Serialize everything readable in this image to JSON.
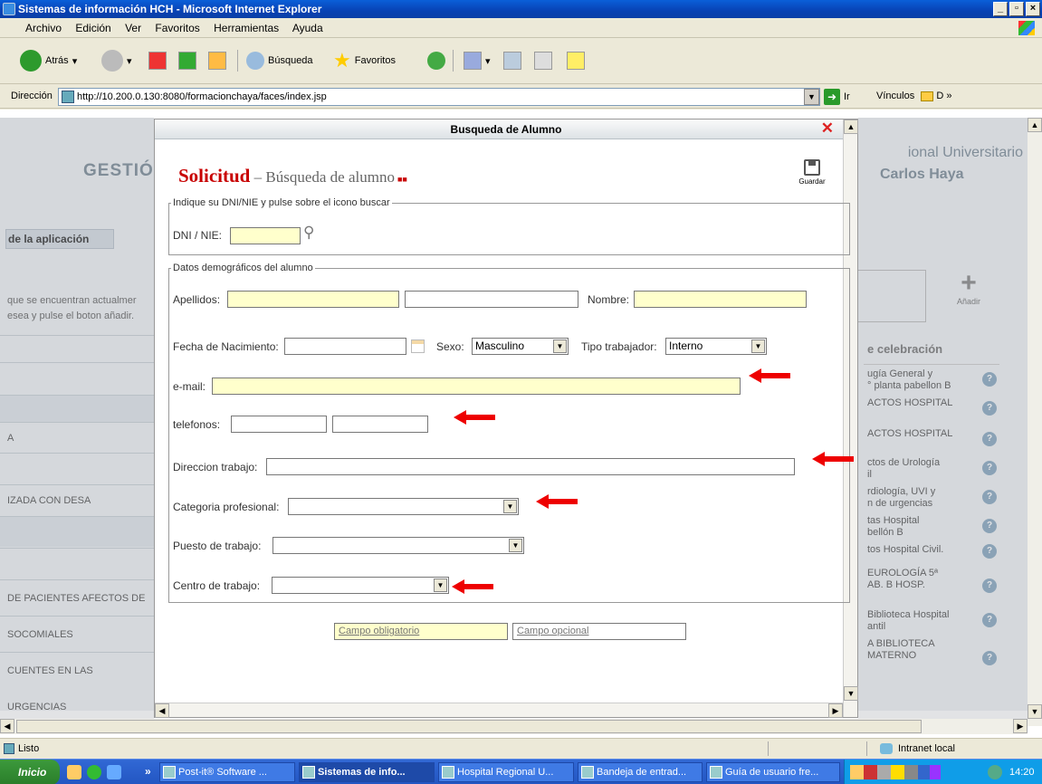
{
  "window": {
    "title": "Sistemas de información HCH - Microsoft Internet Explorer"
  },
  "menu": [
    "Archivo",
    "Edición",
    "Ver",
    "Favoritos",
    "Herramientas",
    "Ayuda"
  ],
  "toolbar": {
    "back": "Atrás",
    "search": "Búsqueda",
    "favorites": "Favoritos"
  },
  "address": {
    "label": "Dirección",
    "url": "http://10.200.0.130:8080/formacionchaya/faces/index.jsp",
    "go": "Ir",
    "links": "Vínculos",
    "links_item": "D"
  },
  "background": {
    "gestion": "GESTIÓN",
    "ayuda": "de la aplicación",
    "desc_line1": "que se encuentran actualmer",
    "desc_line2": "esea y pulse el boton añadir.",
    "right_title1": "ional Universitario",
    "right_title2": "Carlos Haya",
    "add_label": "Añadir",
    "celebracion": "e celebración",
    "rows_left": [
      "A",
      "IZADA CON DESA",
      "DE PACIENTES AFECTOS DE",
      "SOCOMIALES",
      "CUENTES EN LAS URGENCIAS"
    ],
    "rows_right": [
      "ugía General y\n° planta pabellon B",
      "ACTOS HOSPITAL",
      "ACTOS HOSPITAL",
      "ctos de Urología\nil",
      "rdiología, UVI y\nn de urgencias",
      "tas Hospital\nbellón B",
      "tos Hospital Civil.",
      "EUROLOGÍA 5ª\nAB. B HOSP.",
      "Biblioteca Hospital\nantil",
      "A BIBLIOTECA\nMATERNO"
    ]
  },
  "modal": {
    "title": "Busqueda de Alumno",
    "heading_red": "Solicitud",
    "heading_grey": " – Búsqueda de alumno",
    "save": "Guardar",
    "fs1_legend": "Indique su DNI/NIE y pulse sobre el icono buscar",
    "dni_label": "DNI / NIE:",
    "fs2_legend": "Datos demográficos del alumno",
    "apellidos": "Apellidos:",
    "nombre": "Nombre:",
    "fecha": "Fecha de Nacimiento:",
    "sexo": "Sexo:",
    "sexo_value": "Masculino",
    "tipo": "Tipo trabajador:",
    "tipo_value": "Interno",
    "email": "e-mail:",
    "telefonos": "telefonos:",
    "direccion": "Direccion trabajo:",
    "categoria": "Categoria profesional:",
    "puesto": "Puesto de trabajo:",
    "centro": "Centro de trabajo:",
    "legend_required": "Campo obligatorio",
    "legend_optional": "Campo opcional"
  },
  "status": {
    "text": "Listo",
    "zone": "Intranet local"
  },
  "taskbar": {
    "start": "Inicio",
    "tasks": [
      "Post-it® Software ...",
      "Sistemas de info...",
      "Hospital Regional U...",
      "Bandeja de entrad...",
      "Guía de usuario fre..."
    ],
    "clock": "14:20"
  },
  "colors": {
    "required_bg": "#ffffcc",
    "heading_red": "#c80000",
    "arrow": "#ee0000"
  }
}
